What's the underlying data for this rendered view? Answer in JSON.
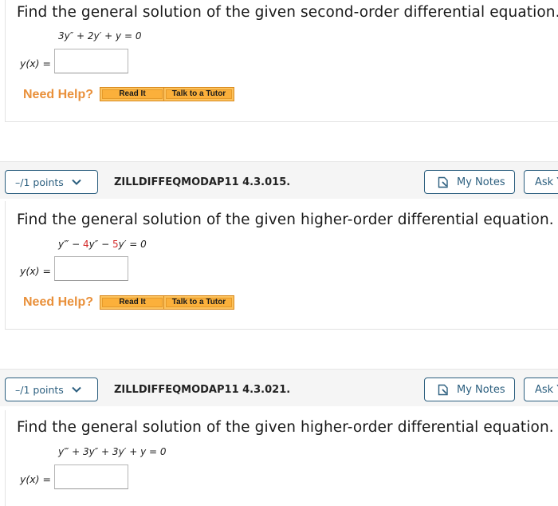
{
  "questions": [
    {
      "prompt": "Find the general solution of the given second-order differential equation.",
      "equation": {
        "p1": "3y″ + 2y′ + y = 0"
      },
      "answer_label": "y(x) =",
      "answer_value": "",
      "need_help": "Need Help?",
      "read_it": "Read It",
      "talk_tutor": "Talk to a Tutor"
    },
    {
      "points": "–/1 points",
      "id": "ZILLDIFFEQMODAP11 4.3.015.",
      "my_notes": "My Notes",
      "ask": "Ask Your Teacher",
      "prompt": "Find the general solution of the given higher-order differential equation.",
      "equation": {
        "a": "y‴ − ",
        "b": "4",
        "c": "y″ − ",
        "d": "5",
        "e": "y′ = 0"
      },
      "answer_label": "y(x) =",
      "answer_value": "",
      "need_help": "Need Help?",
      "read_it": "Read It",
      "talk_tutor": "Talk to a Tutor"
    },
    {
      "points": "–/1 points",
      "id": "ZILLDIFFEQMODAP11 4.3.021.",
      "my_notes": "My Notes",
      "ask": "Ask Your Teacher",
      "prompt": "Find the general solution of the given higher-order differential equation.",
      "equation": {
        "p1": "y‴ + 3y″ + 3y′ + y = 0"
      },
      "answer_label": "y(x) =",
      "answer_value": ""
    }
  ],
  "colors": {
    "accent": "#2c5f7f",
    "need_help": "#e9903a",
    "help_button": "#fbb03b",
    "highlight_red": "#d42a2a"
  }
}
